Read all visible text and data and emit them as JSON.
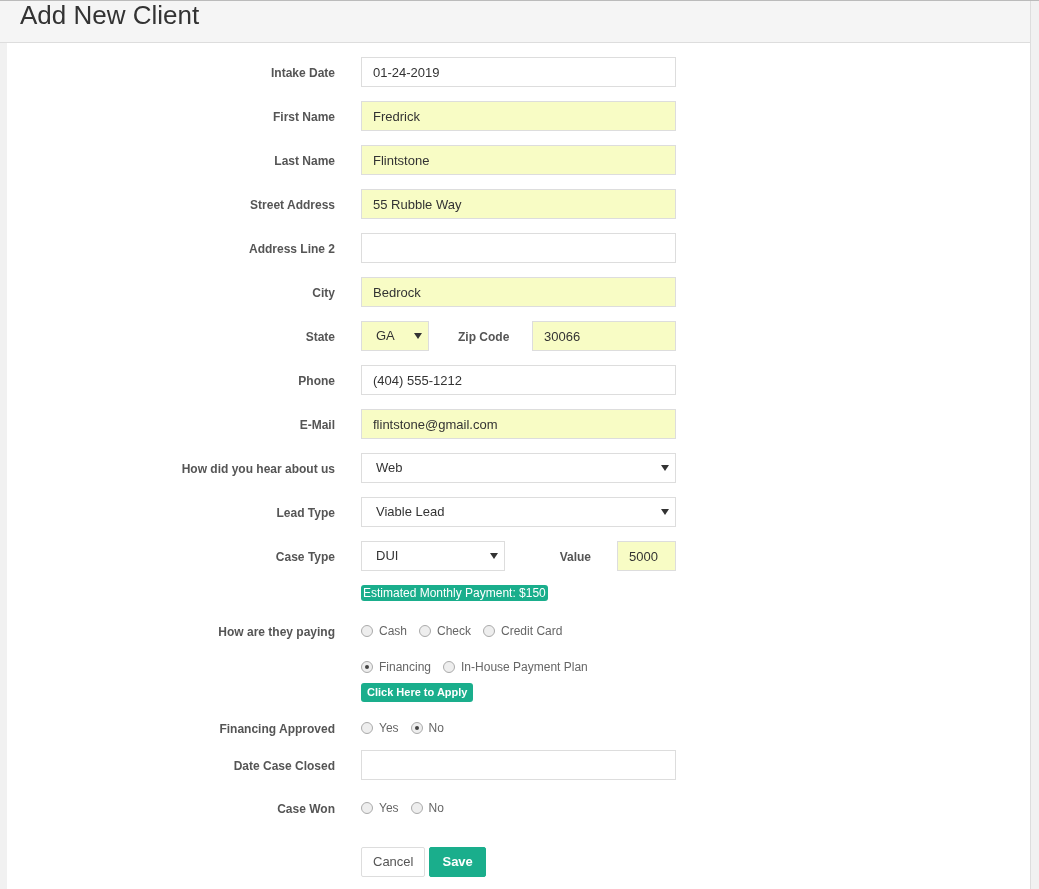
{
  "title": "Add New Client",
  "rows": [
    {
      "kind": "input",
      "label": "Intake Date",
      "value": "01-24-2019",
      "highlighted": false
    },
    {
      "kind": "input",
      "label": "First Name",
      "value": "Fredrick",
      "highlighted": true
    },
    {
      "kind": "input",
      "label": "Last Name",
      "value": "Flintstone",
      "highlighted": true
    },
    {
      "kind": "input",
      "label": "Street Address",
      "value": "55 Rubble Way",
      "highlighted": true
    },
    {
      "kind": "input",
      "label": "Address Line 2",
      "value": "",
      "highlighted": false
    },
    {
      "kind": "input",
      "label": "City",
      "value": "Bedrock",
      "highlighted": true
    },
    {
      "kind": "pair",
      "label": "State",
      "first": {
        "kind": "select",
        "value": "GA",
        "highlighted": true
      },
      "second_label": "Zip Code",
      "second": {
        "kind": "input",
        "value": "30066",
        "highlighted": true
      }
    },
    {
      "kind": "input",
      "label": "Phone",
      "value": "(404) 555-1212",
      "highlighted": false
    },
    {
      "kind": "input",
      "label": "E-Mail",
      "value": "flintstone@gmail.com",
      "highlighted": true
    },
    {
      "kind": "select",
      "label": "How did you hear about us",
      "value": "Web",
      "highlighted": false
    },
    {
      "kind": "select",
      "label": "Lead Type",
      "value": "Viable Lead",
      "highlighted": false
    },
    {
      "kind": "pair",
      "label": "Case Type",
      "first": {
        "kind": "select",
        "value": "DUI",
        "highlighted": false
      },
      "second_label": "Value",
      "second": {
        "kind": "input",
        "value": "5000",
        "highlighted": true
      }
    },
    {
      "kind": "badge",
      "text": "Estimated Monthly Payment: $150"
    },
    {
      "kind": "radios",
      "label": "How are they paying",
      "lines": [
        [
          {
            "label": "Cash",
            "selected": false
          },
          {
            "label": "Check",
            "selected": false
          },
          {
            "label": "Credit Card",
            "selected": false
          }
        ],
        [
          {
            "label": "Financing",
            "selected": true
          },
          {
            "label": "In-House Payment Plan",
            "selected": false
          }
        ]
      ]
    },
    {
      "kind": "button",
      "text": "Click Here to Apply"
    },
    {
      "kind": "radios",
      "label": "Financing Approved",
      "lines": [
        [
          {
            "label": "Yes",
            "selected": false
          },
          {
            "label": "No",
            "selected": true
          }
        ]
      ]
    },
    {
      "kind": "input",
      "label": "Date Case Closed",
      "value": "",
      "highlighted": false
    },
    {
      "kind": "radios",
      "label": "Case Won",
      "lines": [
        [
          {
            "label": "Yes",
            "selected": false
          },
          {
            "label": "No",
            "selected": false
          }
        ]
      ]
    }
  ],
  "buttons": [
    {
      "label": "Cancel",
      "primary": false
    },
    {
      "label": "Save",
      "primary": true
    }
  ]
}
